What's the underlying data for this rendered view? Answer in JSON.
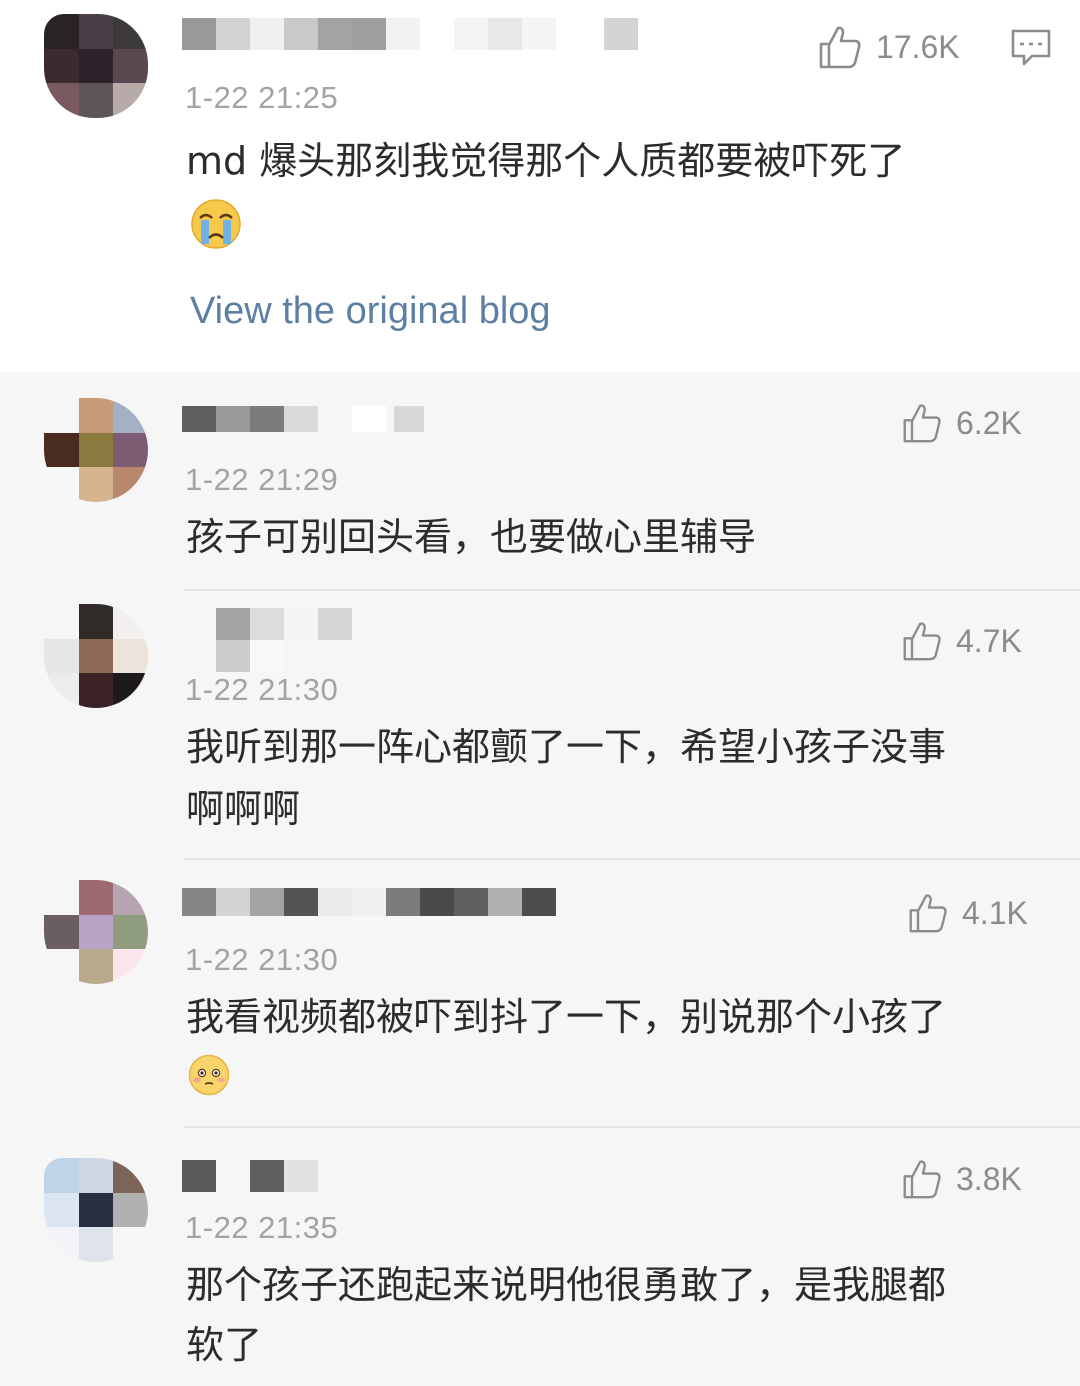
{
  "main_post": {
    "timestamp": "1-22 21:25",
    "text": "md 爆头那刻我觉得那个人质都要被吓死了",
    "emoji": "crying-face",
    "likes": "17.6K",
    "comment_icon": "comment-icon",
    "link_label": "View the original blog"
  },
  "comments": [
    {
      "timestamp": "1-22 21:29",
      "text": "孩子可别回头看，也要做心里辅导",
      "likes": "6.2K"
    },
    {
      "timestamp": "1-22 21:30",
      "text_line1": "我听到那一阵心都颤了一下，希望小孩子没事",
      "text_line2": "啊啊啊",
      "likes": "4.7K"
    },
    {
      "timestamp": "1-22 21:30",
      "text": "我看视频都被吓到抖了一下，别说那个小孩了",
      "emoji": "flushed-face",
      "likes": "4.1K"
    },
    {
      "timestamp": "1-22 21:35",
      "text_line1": "那个孩子还跑起来说明他很勇敢了，是我腿都",
      "text_line2": "软了",
      "likes": "3.8K"
    }
  ],
  "colors": {
    "background": "#f6f6f6",
    "post_background": "#ffffff",
    "text": "#2c2c2c",
    "meta": "#a3a3a3",
    "link": "#5d7fa3"
  }
}
